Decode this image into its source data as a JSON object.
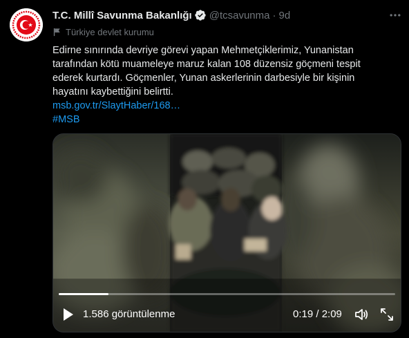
{
  "tweet": {
    "author_name": "T.C. Millî Savunma Bakanlığı",
    "handle": "@tcsavunma",
    "separator": "·",
    "time": "9d",
    "account_label": "Türkiye devlet kurumu",
    "text_lines": [
      "Edirne sınırında devriye görevi yapan Mehmetçiklerimiz, Yunanistan",
      "tarafından kötü muameleye maruz kalan 108 düzensiz göçmeni tespit",
      "ederek kurtardı. Göçmenler, Yunan askerlerinin darbesiyle bir kişinin",
      "hayatını kaybettiğini belirtti."
    ],
    "link": "msb.gov.tr/SlaytHaber/168…",
    "hashtag": "#MSB"
  },
  "video": {
    "views": "1.586 görüntülenme",
    "timecode": "0:19 / 2:09",
    "progress": 0.147
  },
  "icons": {
    "avatar": "msb-emblem-icon",
    "verified": "verified-badge-icon",
    "more": "more-options-icon",
    "label": "flag-icon",
    "play": "play-icon",
    "volume": "volume-icon",
    "fullscreen": "fullscreen-icon"
  },
  "colors": {
    "background": "#000000",
    "text": "#e7e9ea",
    "secondary": "#71767b",
    "link": "#1d9bf0",
    "emblem_red": "#e30a17"
  }
}
